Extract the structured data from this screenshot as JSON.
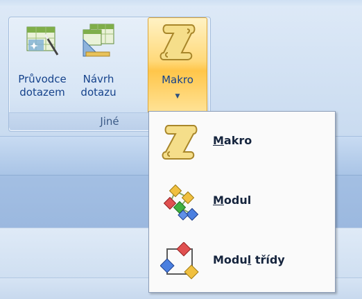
{
  "ribbon": {
    "group_label": "Jiné",
    "buttons": [
      {
        "line1": "Průvodce",
        "line2": "dotazem",
        "icon": "query-wizard-icon"
      },
      {
        "line1": "Návrh",
        "line2": "dotazu",
        "icon": "query-design-icon"
      },
      {
        "line1": "Makro",
        "icon": "macro-scroll-icon",
        "arrow": "▼"
      }
    ]
  },
  "menu": {
    "items": [
      {
        "pre": "",
        "ul": "M",
        "post": "akro",
        "icon": "macro-scroll-icon"
      },
      {
        "pre": "",
        "ul": "M",
        "post": "odul",
        "icon": "module-icon"
      },
      {
        "pre": "Modu",
        "ul": "l",
        "post": " třídy",
        "icon": "class-module-icon"
      }
    ]
  },
  "colors": {
    "ribbon_text": "#15428b",
    "menu_text": "#15243d",
    "active_button": "#ffd97a"
  }
}
